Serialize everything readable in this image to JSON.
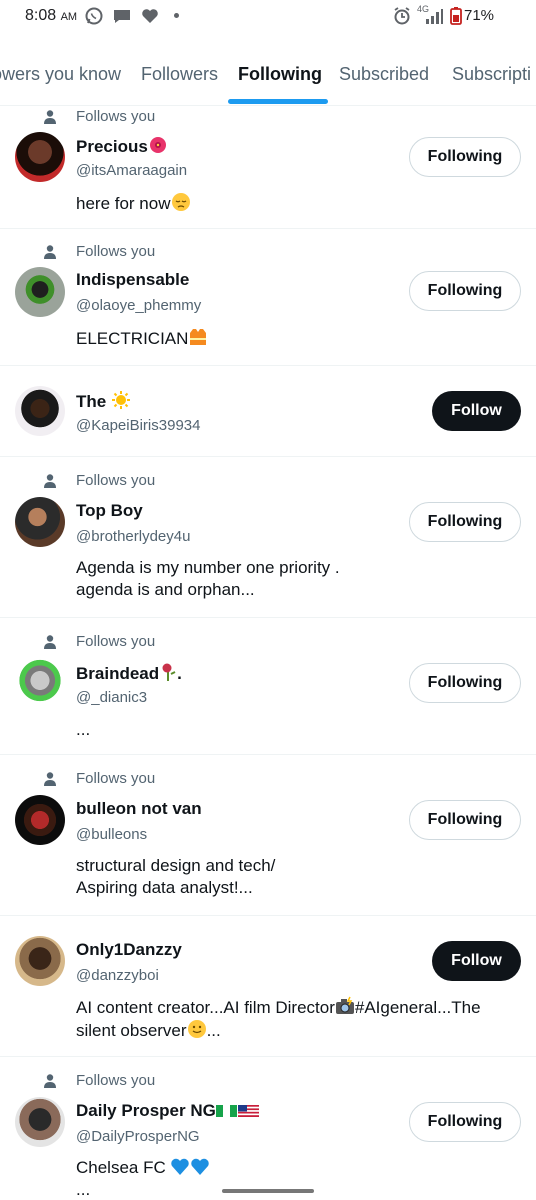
{
  "status_bar": {
    "time": "8:08",
    "ampm": "AM",
    "network": "4G",
    "battery": "71%"
  },
  "tabs": [
    {
      "label": "owers you know",
      "active": false
    },
    {
      "label": "Followers",
      "active": false
    },
    {
      "label": "Following",
      "active": true
    },
    {
      "label": "Subscribed",
      "active": false
    },
    {
      "label": "Subscripti",
      "active": false
    }
  ],
  "follows_you_label": "Follows you",
  "users": [
    {
      "name": "Precious",
      "handle": "@itsAmaraagain",
      "bio": "here for now",
      "follows_you": true,
      "button": "Following",
      "name_emoji": "hibiscus",
      "bio_emoji": "pensive-face"
    },
    {
      "name": "Indispensable",
      "handle": "@olaoye_phemmy",
      "bio": "ELECTRICIAN",
      "follows_you": true,
      "button": "Following",
      "bio_emoji": "safety-vest"
    },
    {
      "name": "The",
      "handle": "@KapeiBiris39934",
      "bio": "",
      "follows_you": false,
      "button": "Follow",
      "name_emoji": "sun"
    },
    {
      "name": "Top Boy",
      "handle": "@brotherlydey4u",
      "bio_line1": "Agenda is my number one priority .",
      "bio_line2": "agenda is and orphan...",
      "follows_you": true,
      "button": "Following"
    },
    {
      "name": "Braindead",
      "name_suffix": ".",
      "handle": "@_dianic3",
      "bio": "...",
      "follows_you": true,
      "button": "Following",
      "name_emoji": "wilted-flower"
    },
    {
      "name": "bulleon not van",
      "handle": "@bulleons",
      "bio_line1": "structural design and tech/",
      "bio_line2": "Aspiring data analyst!...",
      "follows_you": true,
      "button": "Following"
    },
    {
      "name": "Only1Danzzy",
      "handle": "@danzzyboi",
      "bio_line1_a": "AI content creator...AI film Director",
      "bio_line1_b": "#AIgeneral...The",
      "bio_line2_a": "silent observer",
      "bio_line2_b": "...",
      "follows_you": false,
      "button": "Follow",
      "bio_emoji": "camera-flash"
    },
    {
      "name": "Daily Prosper NG",
      "handle": "@DailyProsperNG",
      "bio_line1": "Chelsea FC",
      "bio_line2": "...",
      "follows_you": true,
      "button": "Following",
      "name_emoji": "flags-nigeria-usa",
      "bio_emoji": "blue-hearts"
    }
  ],
  "colors": {
    "accent": "#1d9bf0",
    "text": "#0f1419",
    "secondary": "#536471",
    "follow_btn_bg": "#0f1419"
  }
}
